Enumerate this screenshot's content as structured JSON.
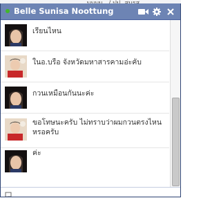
{
  "background": {
    "partial_text": "บบบบ.../ ปป. สมรส"
  },
  "chat": {
    "title": "Belle Sunisa Noottung",
    "status": "online",
    "colors": {
      "titlebar": "#6d84b4",
      "online": "#42b72a"
    },
    "icons": [
      "video-camera-icon",
      "gear-icon",
      "close-icon"
    ],
    "messages": [
      {
        "text": "เรียนไหน",
        "sender": "dark-hair-avatar"
      },
      {
        "text": "ในอ.บรือ จังหวัดมหาสารคามอ่ะคับ",
        "sender": "red-shirt-avatar"
      },
      {
        "text": "กวนเหมือนกันนะค่ะ",
        "sender": "dark-hair-avatar"
      },
      {
        "text": "ขอโทษนะครับ ไม่ทราบว่าผมกวนตรงไหนหรอครับ",
        "sender": "red-shirt-avatar"
      },
      {
        "text": "ค่ะ",
        "sender": "dark-hair-avatar"
      }
    ],
    "composer": {
      "icon": "compose-icon",
      "value": ""
    }
  }
}
